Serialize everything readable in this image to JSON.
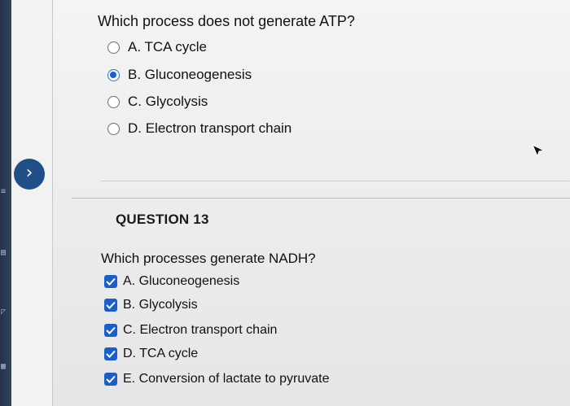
{
  "question1": {
    "text": "Which process does not generate ATP?",
    "options": [
      {
        "label": "A. TCA cycle",
        "selected": false
      },
      {
        "label": "B. Gluconeogenesis",
        "selected": true
      },
      {
        "label": "C. Glycolysis",
        "selected": false
      },
      {
        "label": "D. Electron transport chain",
        "selected": false
      }
    ]
  },
  "question13": {
    "heading": "QUESTION 13",
    "text": "Which processes generate NADH?",
    "options": [
      {
        "label": "A. Gluconeogenesis",
        "checked": true
      },
      {
        "label": "B. Glycolysis",
        "checked": true
      },
      {
        "label": "C. Electron transport chain",
        "checked": true
      },
      {
        "label": "D. TCA cycle",
        "checked": true
      },
      {
        "label": "E. Conversion of lactate to pyruvate",
        "checked": true
      }
    ]
  },
  "sidebar": {
    "nav_arrow_icon": "chevron-right-icon",
    "nav_arrow_glyph": "›"
  },
  "colors": {
    "accent": "#1660d8",
    "checkbox": "#1a5fc9",
    "left_bezel": "#23324a"
  }
}
